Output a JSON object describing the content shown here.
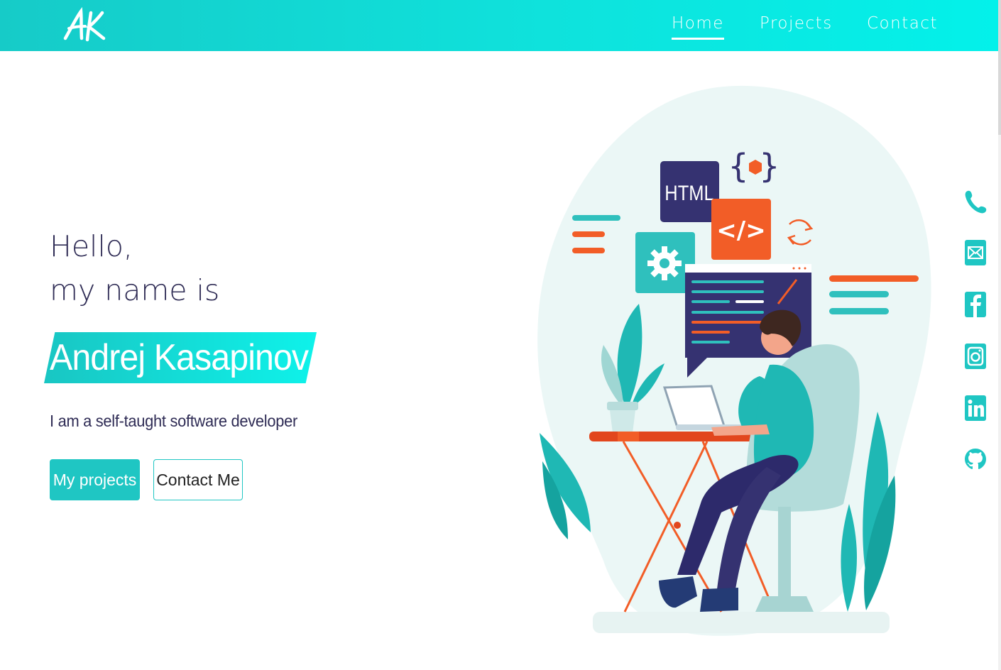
{
  "brand": {
    "logo_text": "AK"
  },
  "nav": {
    "home": "Home",
    "projects": "Projects",
    "contact": "Contact"
  },
  "hero": {
    "greeting_line1": "Hello,",
    "greeting_line2": "my name is",
    "name": "Andrej Kasapinov",
    "tagline": "I am a self-taught software developer",
    "btn_projects": "My projects",
    "btn_contact": "Contact Me"
  },
  "illustration": {
    "html_card": "HTML",
    "code_tag": "</>"
  },
  "social": [
    "phone-icon",
    "mail-icon",
    "facebook-icon",
    "instagram-icon",
    "linkedin-icon",
    "github-icon"
  ],
  "colors": {
    "accent": "#1fc6c3",
    "dark_text": "#2f2c55",
    "orange": "#f25d27",
    "navy": "#353271"
  }
}
